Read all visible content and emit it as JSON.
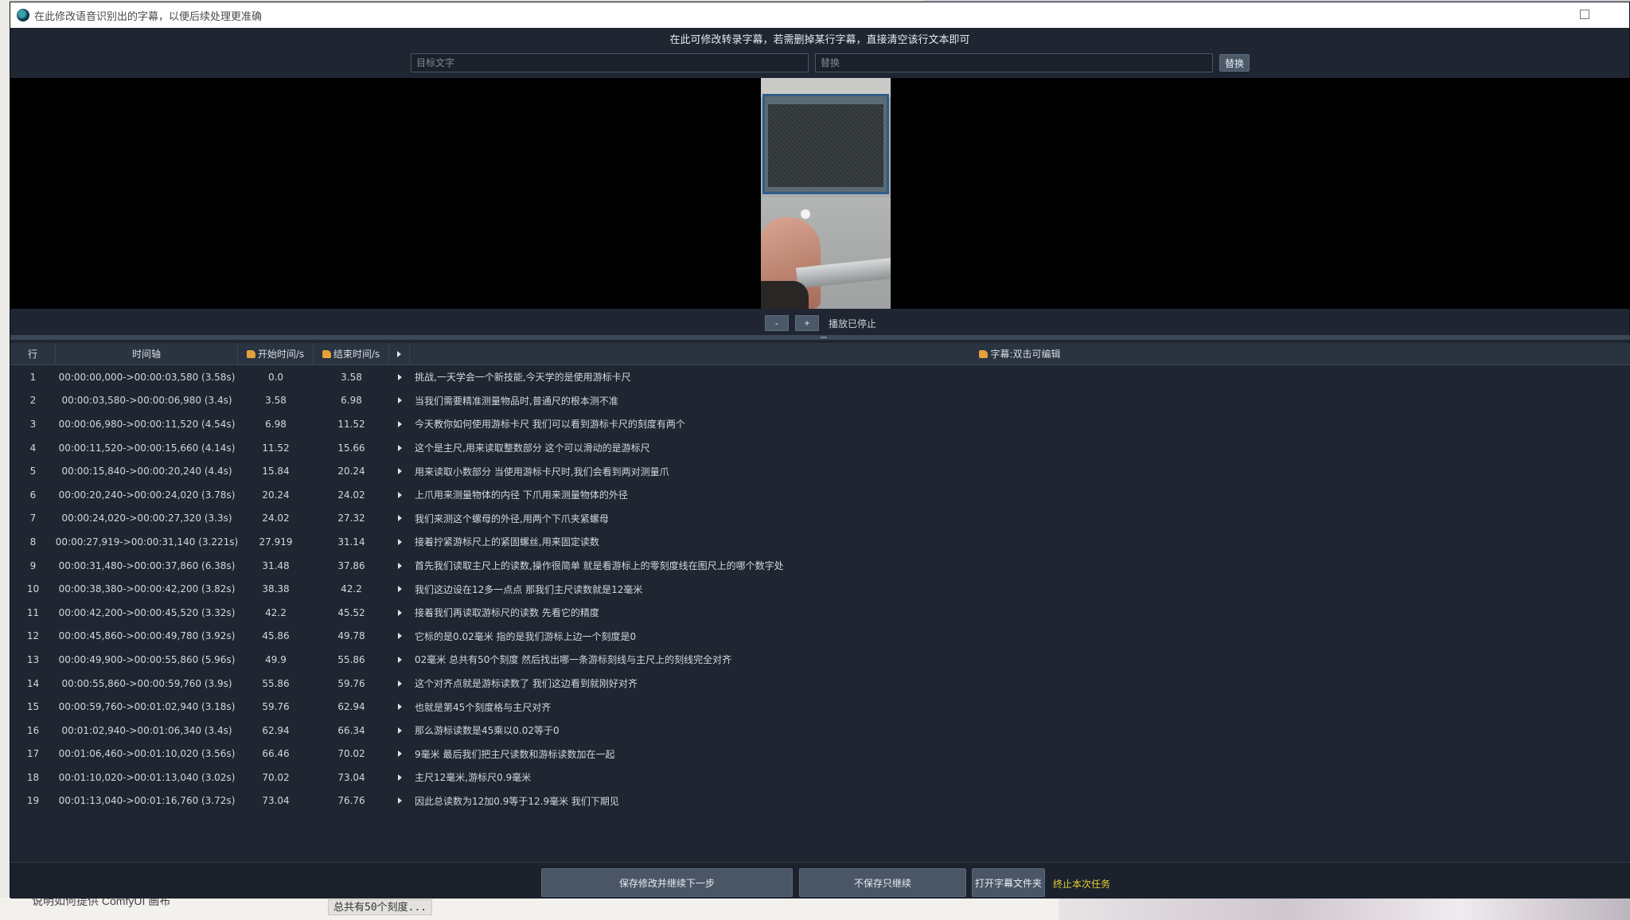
{
  "window": {
    "title": "在此修改语音识别出的字幕，以便后续处理更准确",
    "hint": "在此可修改转录字幕，若需删掉某行字幕，直接清空该行文本即可"
  },
  "replace": {
    "target_placeholder": "目标文字",
    "replace_placeholder": "替换",
    "button_label": "替换"
  },
  "player": {
    "minus_label": "-",
    "plus_label": "+",
    "status": "播放已停止"
  },
  "table": {
    "headers": {
      "row": "行",
      "timeline": "时间轴",
      "start": "开始时间/s",
      "end": "结束时间/s",
      "subtitle": "字幕:双击可编辑"
    },
    "rows": [
      {
        "row": "1",
        "timeline": "00:00:00,000->00:00:03,580 (3.58s)",
        "start": "0.0",
        "end": "3.58",
        "text": "挑战,一天学会一个新技能,今天学的是使用游标卡尺"
      },
      {
        "row": "2",
        "timeline": "00:00:03,580->00:00:06,980 (3.4s)",
        "start": "3.58",
        "end": "6.98",
        "text": "当我们需要精准测量物品时,普通尺的根本测不准"
      },
      {
        "row": "3",
        "timeline": "00:00:06,980->00:00:11,520 (4.54s)",
        "start": "6.98",
        "end": "11.52",
        "text": "今天教你如何使用游标卡尺 我们可以看到游标卡尺的刻度有两个"
      },
      {
        "row": "4",
        "timeline": "00:00:11,520->00:00:15,660 (4.14s)",
        "start": "11.52",
        "end": "15.66",
        "text": "这个是主尺,用来读取整数部分 这个可以滑动的是游标尺"
      },
      {
        "row": "5",
        "timeline": "00:00:15,840->00:00:20,240 (4.4s)",
        "start": "15.84",
        "end": "20.24",
        "text": "用来读取小数部分 当使用游标卡尺时,我们会看到两对测量爪"
      },
      {
        "row": "6",
        "timeline": "00:00:20,240->00:00:24,020 (3.78s)",
        "start": "20.24",
        "end": "24.02",
        "text": "上爪用来测量物体的内径 下爪用来测量物体的外径"
      },
      {
        "row": "7",
        "timeline": "00:00:24,020->00:00:27,320 (3.3s)",
        "start": "24.02",
        "end": "27.32",
        "text": "我们来测这个螺母的外径,用两个下爪夹紧螺母"
      },
      {
        "row": "8",
        "timeline": "00:00:27,919->00:00:31,140 (3.221s)",
        "start": "27.919",
        "end": "31.14",
        "text": "接着拧紧游标尺上的紧固螺丝,用来固定读数"
      },
      {
        "row": "9",
        "timeline": "00:00:31,480->00:00:37,860 (6.38s)",
        "start": "31.48",
        "end": "37.86",
        "text": "首先我们读取主尺上的读数,操作很简单 就是看游标上的零刻度线在图尺上的哪个数字处"
      },
      {
        "row": "10",
        "timeline": "00:00:38,380->00:00:42,200 (3.82s)",
        "start": "38.38",
        "end": "42.2",
        "text": "我们这边设在12多一点点 那我们主尺读数就是12毫米"
      },
      {
        "row": "11",
        "timeline": "00:00:42,200->00:00:45,520 (3.32s)",
        "start": "42.2",
        "end": "45.52",
        "text": "接着我们再读取游标尺的读数 先看它的精度"
      },
      {
        "row": "12",
        "timeline": "00:00:45,860->00:00:49,780 (3.92s)",
        "start": "45.86",
        "end": "49.78",
        "text": "它标的是0.02毫米 指的是我们游标上边一个刻度是0"
      },
      {
        "row": "13",
        "timeline": "00:00:49,900->00:00:55,860 (5.96s)",
        "start": "49.9",
        "end": "55.86",
        "text": "02毫米 总共有50个刻度 然后找出哪一条游标刻线与主尺上的刻线完全对齐"
      },
      {
        "row": "14",
        "timeline": "00:00:55,860->00:00:59,760 (3.9s)",
        "start": "55.86",
        "end": "59.76",
        "text": "这个对齐点就是游标读数了 我们这边看到就刚好对齐"
      },
      {
        "row": "15",
        "timeline": "00:00:59,760->00:01:02,940 (3.18s)",
        "start": "59.76",
        "end": "62.94",
        "text": "也就是第45个刻度格与主尺对齐"
      },
      {
        "row": "16",
        "timeline": "00:01:02,940->00:01:06,340 (3.4s)",
        "start": "62.94",
        "end": "66.34",
        "text": "那么游标读数是45乘以0.02等于0"
      },
      {
        "row": "17",
        "timeline": "00:01:06,460->00:01:10,020 (3.56s)",
        "start": "66.46",
        "end": "70.02",
        "text": "9毫米 最后我们把主尺读数和游标读数加在一起"
      },
      {
        "row": "18",
        "timeline": "00:01:10,020->00:01:13,040 (3.02s)",
        "start": "70.02",
        "end": "73.04",
        "text": "主尺12毫米,游标尺0.9毫米"
      },
      {
        "row": "19",
        "timeline": "00:01:13,040->00:01:16,760 (3.72s)",
        "start": "73.04",
        "end": "76.76",
        "text": "因此总读数为12加0.9等于12.9毫米 我们下期见"
      }
    ]
  },
  "footer": {
    "save_next": "保存修改并继续下一步",
    "no_save": "不保存只继续",
    "open_folder": "打开字幕文件夹",
    "stop_task": "终止本次任务"
  },
  "background": {
    "bottom_text": "说明如何提供 ComfyUI 画布",
    "bottom_chip": "总共有50个刻度..."
  },
  "colors": {
    "window_bg": "#1f2632",
    "accent_yellow": "#e6d23a",
    "button_bg": "#4a5666"
  },
  "icons": {
    "app": "app-logo-icon",
    "edit_hand": "hand-icon",
    "play": "play-triangle-icon"
  }
}
